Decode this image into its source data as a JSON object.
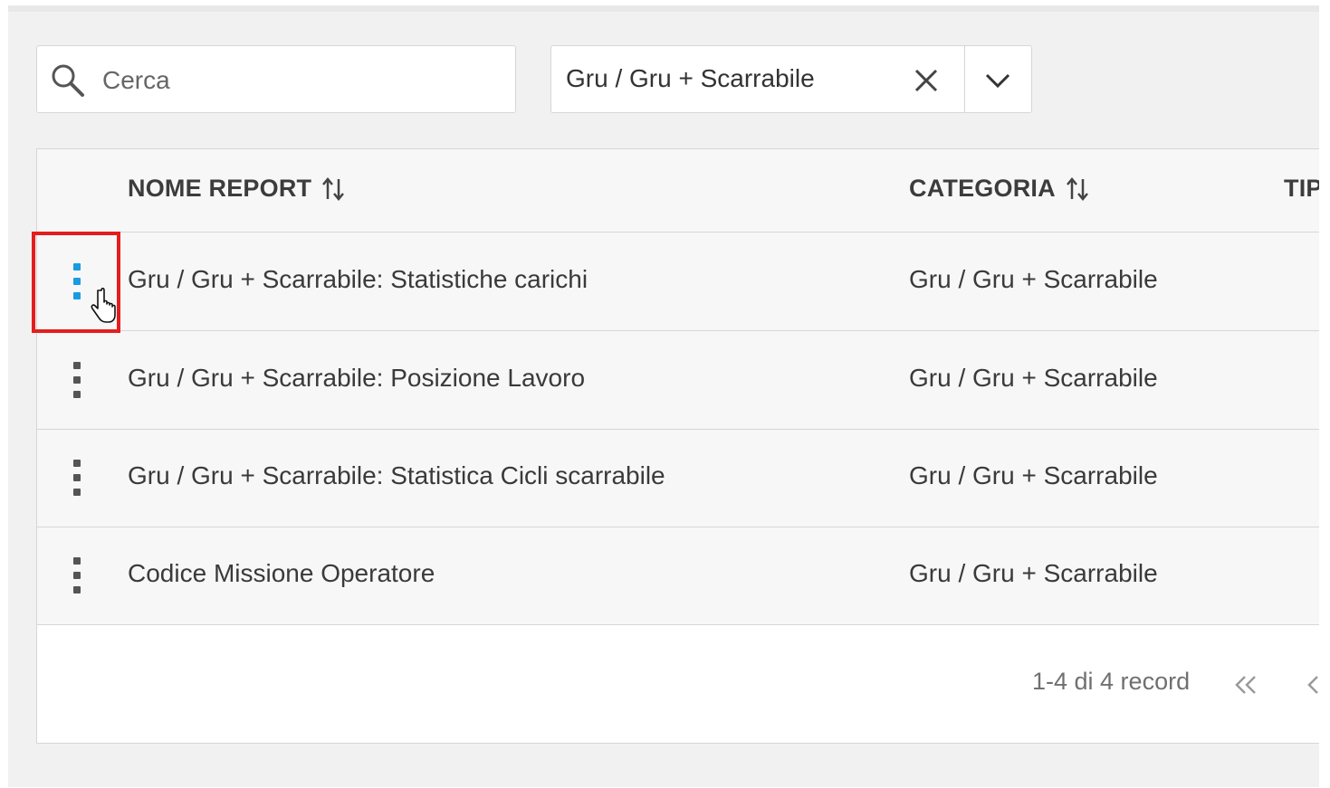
{
  "search": {
    "placeholder": "Cerca",
    "value": ""
  },
  "category_filter": {
    "selected": "Gru / Gru + Scarrabile"
  },
  "table": {
    "columns": [
      {
        "label": "NOME REPORT",
        "sortable": true
      },
      {
        "label": "CATEGORIA",
        "sortable": true
      },
      {
        "label": "TIP",
        "sortable": false
      }
    ],
    "rows": [
      {
        "name": "Gru / Gru + Scarrabile: Statistiche carichi",
        "category": "Gru / Gru + Scarrabile",
        "highlighted": true
      },
      {
        "name": "Gru / Gru + Scarrabile: Posizione Lavoro",
        "category": "Gru / Gru + Scarrabile",
        "highlighted": false
      },
      {
        "name": "Gru / Gru + Scarrabile: Statistica Cicli scarrabile",
        "category": "Gru / Gru + Scarrabile",
        "highlighted": false
      },
      {
        "name": "Codice Missione Operatore",
        "category": "Gru / Gru + Scarrabile",
        "highlighted": false
      }
    ]
  },
  "pagination": {
    "summary": "1-4 di 4 record",
    "first_icon": "double-chevron-left-icon",
    "prev_icon": "chevron-left-icon"
  },
  "colors": {
    "accent": "#1a9be0",
    "highlight_box": "#e41e1e",
    "background": "#f1f1f1"
  }
}
